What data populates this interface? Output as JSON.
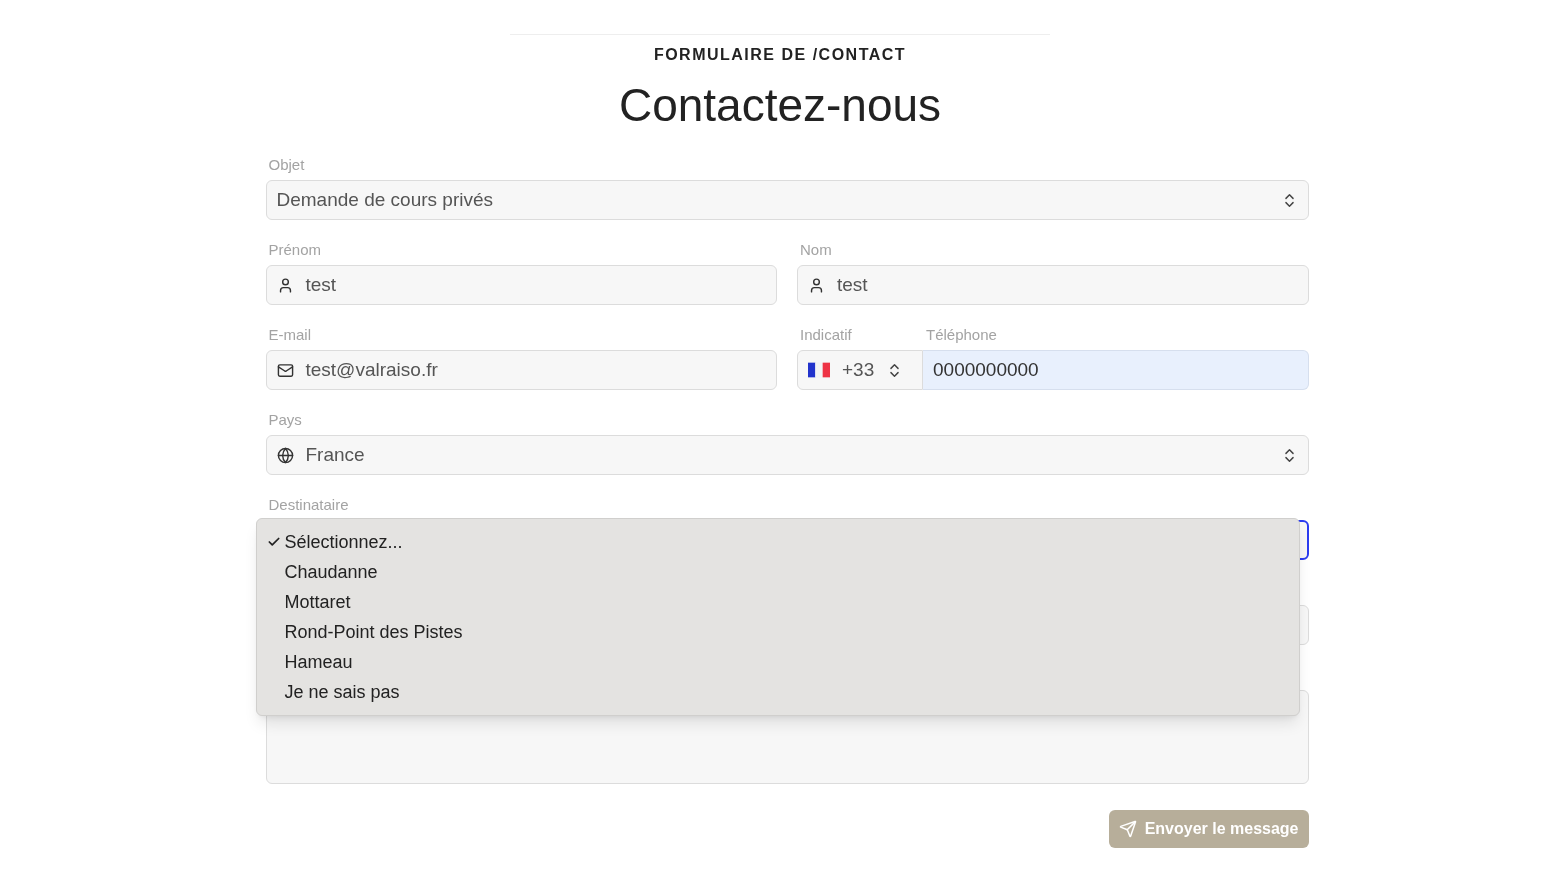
{
  "eyebrow": "FORMULAIRE DE /CONTACT",
  "heading": "Contactez-nous",
  "objet": {
    "label": "Objet",
    "value": "Demande de cours privés"
  },
  "prenom": {
    "label": "Prénom",
    "value": "test"
  },
  "nom": {
    "label": "Nom",
    "value": "test"
  },
  "email": {
    "label": "E-mail",
    "value": "test@valraiso.fr"
  },
  "indicatif": {
    "label": "Indicatif",
    "value": "+33"
  },
  "telephone": {
    "label": "Téléphone",
    "value": "0000000000"
  },
  "pays": {
    "label": "Pays",
    "value": "France"
  },
  "destinataire": {
    "label": "Destinataire",
    "expanded": true,
    "options": [
      {
        "label": "Sélectionnez...",
        "selected": true
      },
      {
        "label": "Chaudanne",
        "selected": false
      },
      {
        "label": "Mottaret",
        "selected": false
      },
      {
        "label": "Rond-Point des Pistes",
        "selected": false
      },
      {
        "label": "Hameau",
        "selected": false
      },
      {
        "label": "Je ne sais pas",
        "selected": false
      }
    ]
  },
  "submit": {
    "label": "Envoyer le message"
  }
}
